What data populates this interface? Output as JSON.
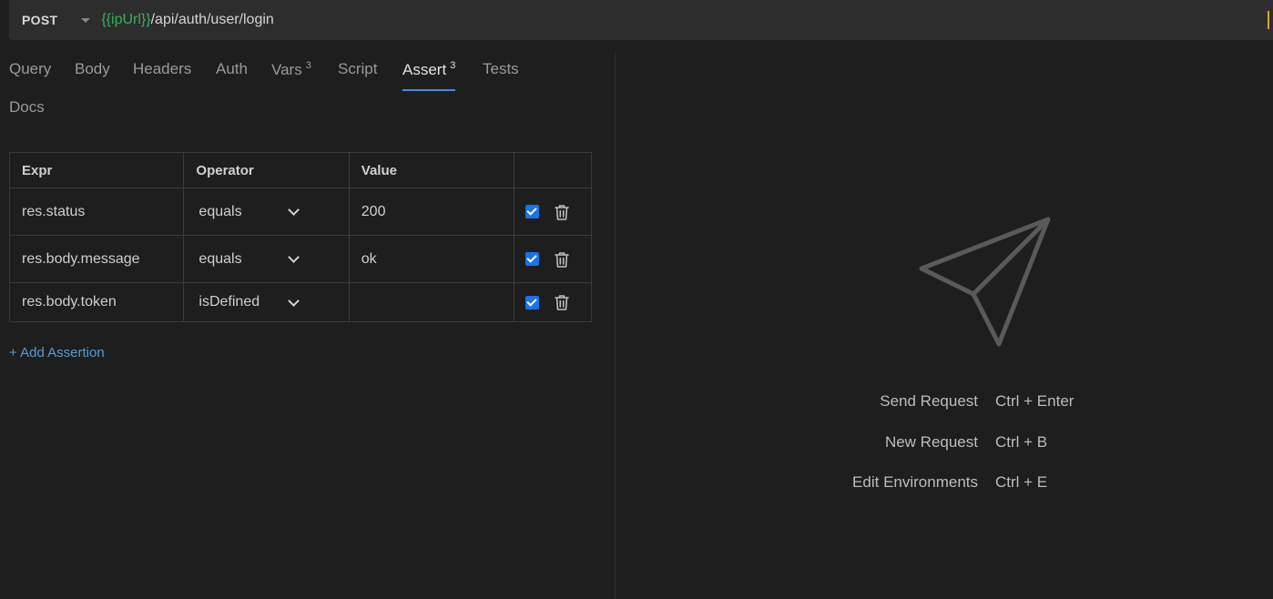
{
  "request": {
    "method": "POST",
    "url_var": "{{ipUrl}}",
    "url_path": "/api/auth/user/login"
  },
  "tabs": [
    {
      "label": "Query"
    },
    {
      "label": "Body"
    },
    {
      "label": "Headers"
    },
    {
      "label": "Auth"
    },
    {
      "label": "Vars",
      "count": "3"
    },
    {
      "label": "Script"
    },
    {
      "label": "Assert",
      "count": "3",
      "active": true
    },
    {
      "label": "Tests"
    },
    {
      "label": "Docs"
    }
  ],
  "assertions": {
    "headers": {
      "expr": "Expr",
      "operator": "Operator",
      "value": "Value"
    },
    "rows": [
      {
        "expr": "res.status",
        "operator": "equals",
        "value": "200",
        "enabled": true
      },
      {
        "expr": "res.body.message",
        "operator": "equals",
        "value": "ok",
        "enabled": true
      },
      {
        "expr": "res.body.token",
        "operator": "isDefined",
        "value": "",
        "enabled": true
      }
    ],
    "add_label": "+ Add Assertion"
  },
  "shortcuts": [
    {
      "label": "Send Request",
      "keys": "Ctrl + Enter"
    },
    {
      "label": "New Request",
      "keys": "Ctrl + B"
    },
    {
      "label": "Edit Environments",
      "keys": "Ctrl + E"
    }
  ],
  "icons": {
    "send": "paper-plane-icon",
    "trash": "trash-icon",
    "dropdown": "chevron-down-icon"
  },
  "colors": {
    "accent": "#4a8ad6",
    "variable": "#3fae5a",
    "checkbox": "#1a73e8",
    "link": "#5a9bd5"
  }
}
